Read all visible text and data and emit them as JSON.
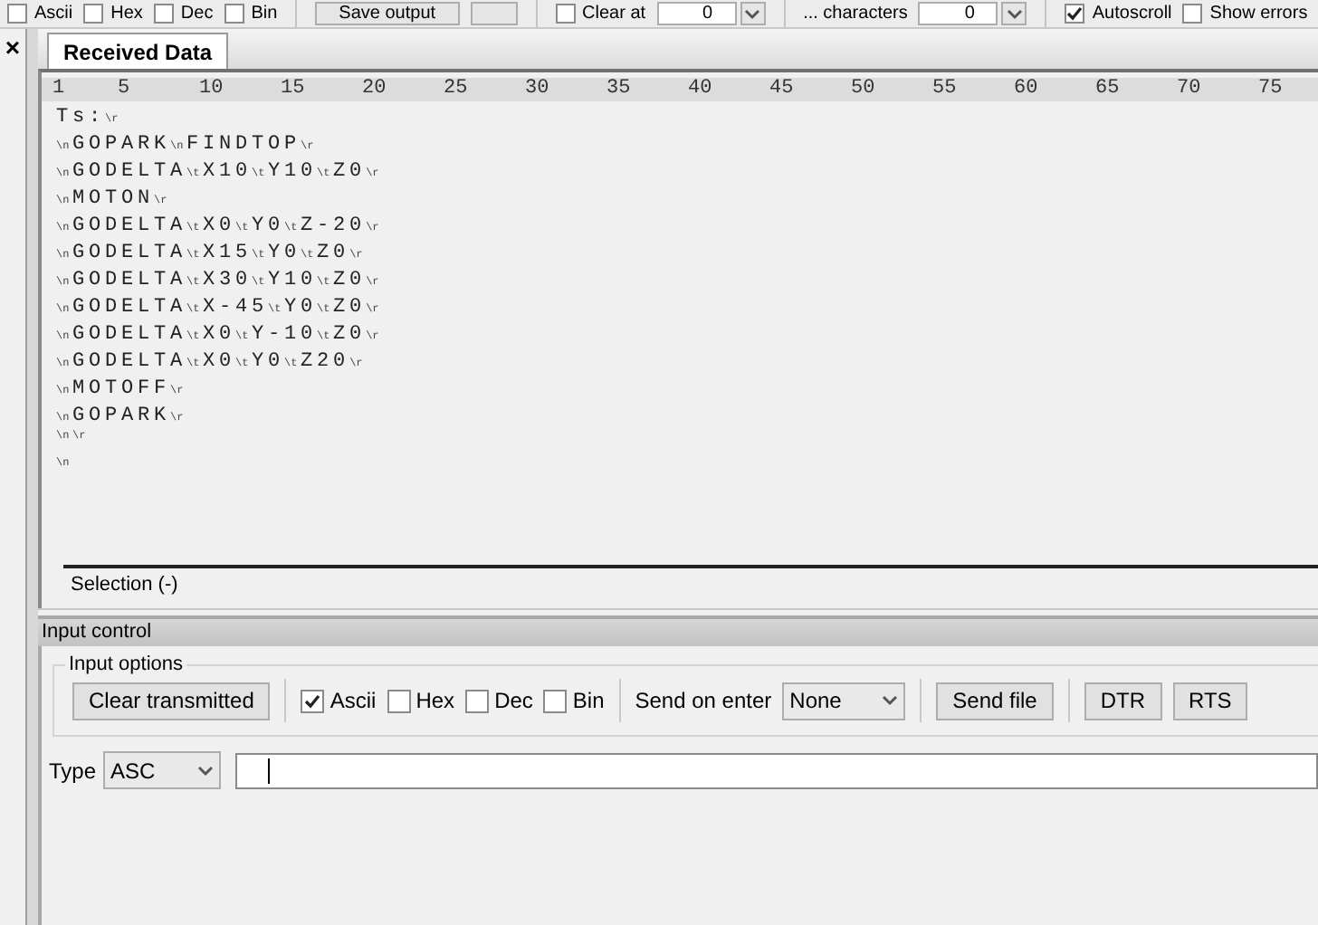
{
  "toolbar": {
    "items": [
      {
        "kind": "checkbox",
        "label": "Ascii",
        "checked": false
      },
      {
        "kind": "checkbox",
        "label": "Hex",
        "checked": false
      },
      {
        "kind": "checkbox",
        "label": "Dec",
        "checked": false
      },
      {
        "kind": "checkbox",
        "label": "Bin",
        "checked": false
      },
      {
        "kind": "sep"
      },
      {
        "kind": "button",
        "label": "Save output"
      },
      {
        "kind": "button"
      },
      {
        "kind": "sep"
      },
      {
        "kind": "checkbox",
        "label": "Clear at",
        "checked": false
      },
      {
        "kind": "spin",
        "value": "0"
      },
      {
        "kind": "sep"
      },
      {
        "kind": "text",
        "label": "... characters"
      },
      {
        "kind": "spin",
        "value": "0"
      },
      {
        "kind": "sep"
      },
      {
        "kind": "checkbox",
        "label": "Autoscroll",
        "checked": true
      },
      {
        "kind": "checkbox",
        "label": "Show errors",
        "checked": false
      }
    ]
  },
  "side_panel": {
    "close": "×"
  },
  "tabs": [
    {
      "label": "Received Data",
      "selected": true
    }
  ],
  "ruler": [
    "1",
    "5",
    "10",
    "15",
    "20",
    "25",
    "30",
    "35",
    "40",
    "45",
    "50",
    "55",
    "60",
    "65",
    "70",
    "75"
  ],
  "received_lines": [
    [
      {
        "kind": "text",
        "text": "Ts:"
      },
      {
        "kind": "ctrl",
        "text": "\\r"
      }
    ],
    [
      {
        "kind": "ctrl",
        "text": "\\n"
      },
      {
        "kind": "text",
        "text": "GOPARK"
      },
      {
        "kind": "ctrl",
        "text": "\\n"
      },
      {
        "kind": "text",
        "text": "FINDTOP"
      },
      {
        "kind": "ctrl",
        "text": "\\r"
      }
    ],
    [
      {
        "kind": "ctrl",
        "text": "\\n"
      },
      {
        "kind": "text",
        "text": "GODELTA"
      },
      {
        "kind": "ctrl",
        "text": "\\t"
      },
      {
        "kind": "text",
        "text": "X10"
      },
      {
        "kind": "ctrl",
        "text": "\\t"
      },
      {
        "kind": "text",
        "text": "Y10"
      },
      {
        "kind": "ctrl",
        "text": "\\t"
      },
      {
        "kind": "text",
        "text": "Z0"
      },
      {
        "kind": "ctrl",
        "text": "\\r"
      }
    ],
    [
      {
        "kind": "ctrl",
        "text": "\\n"
      },
      {
        "kind": "text",
        "text": "MOTON"
      },
      {
        "kind": "ctrl",
        "text": "\\r"
      }
    ],
    [
      {
        "kind": "ctrl",
        "text": "\\n"
      },
      {
        "kind": "text",
        "text": "GODELTA"
      },
      {
        "kind": "ctrl",
        "text": "\\t"
      },
      {
        "kind": "text",
        "text": "X0"
      },
      {
        "kind": "ctrl",
        "text": "\\t"
      },
      {
        "kind": "text",
        "text": "Y0"
      },
      {
        "kind": "ctrl",
        "text": "\\t"
      },
      {
        "kind": "text",
        "text": "Z-20"
      },
      {
        "kind": "ctrl",
        "text": "\\r"
      }
    ],
    [
      {
        "kind": "ctrl",
        "text": "\\n"
      },
      {
        "kind": "text",
        "text": "GODELTA"
      },
      {
        "kind": "ctrl",
        "text": "\\t"
      },
      {
        "kind": "text",
        "text": "X15"
      },
      {
        "kind": "ctrl",
        "text": "\\t"
      },
      {
        "kind": "text",
        "text": "Y0"
      },
      {
        "kind": "ctrl",
        "text": "\\t"
      },
      {
        "kind": "text",
        "text": "Z0"
      },
      {
        "kind": "ctrl",
        "text": "\\r"
      }
    ],
    [
      {
        "kind": "ctrl",
        "text": "\\n"
      },
      {
        "kind": "text",
        "text": "GODELTA"
      },
      {
        "kind": "ctrl",
        "text": "\\t"
      },
      {
        "kind": "text",
        "text": "X30"
      },
      {
        "kind": "ctrl",
        "text": "\\t"
      },
      {
        "kind": "text",
        "text": "Y10"
      },
      {
        "kind": "ctrl",
        "text": "\\t"
      },
      {
        "kind": "text",
        "text": "Z0"
      },
      {
        "kind": "ctrl",
        "text": "\\r"
      }
    ],
    [
      {
        "kind": "ctrl",
        "text": "\\n"
      },
      {
        "kind": "text",
        "text": "GODELTA"
      },
      {
        "kind": "ctrl",
        "text": "\\t"
      },
      {
        "kind": "text",
        "text": "X-45"
      },
      {
        "kind": "ctrl",
        "text": "\\t"
      },
      {
        "kind": "text",
        "text": "Y0"
      },
      {
        "kind": "ctrl",
        "text": "\\t"
      },
      {
        "kind": "text",
        "text": "Z0"
      },
      {
        "kind": "ctrl",
        "text": "\\r"
      }
    ],
    [
      {
        "kind": "ctrl",
        "text": "\\n"
      },
      {
        "kind": "text",
        "text": "GODELTA"
      },
      {
        "kind": "ctrl",
        "text": "\\t"
      },
      {
        "kind": "text",
        "text": "X0"
      },
      {
        "kind": "ctrl",
        "text": "\\t"
      },
      {
        "kind": "text",
        "text": "Y-10"
      },
      {
        "kind": "ctrl",
        "text": "\\t"
      },
      {
        "kind": "text",
        "text": "Z0"
      },
      {
        "kind": "ctrl",
        "text": "\\r"
      }
    ],
    [
      {
        "kind": "ctrl",
        "text": "\\n"
      },
      {
        "kind": "text",
        "text": "GODELTA"
      },
      {
        "kind": "ctrl",
        "text": "\\t"
      },
      {
        "kind": "text",
        "text": "X0"
      },
      {
        "kind": "ctrl",
        "text": "\\t"
      },
      {
        "kind": "text",
        "text": "Y0"
      },
      {
        "kind": "ctrl",
        "text": "\\t"
      },
      {
        "kind": "text",
        "text": "Z20"
      },
      {
        "kind": "ctrl",
        "text": "\\r"
      }
    ],
    [
      {
        "kind": "ctrl",
        "text": "\\n"
      },
      {
        "kind": "text",
        "text": "MOTOFF"
      },
      {
        "kind": "ctrl",
        "text": "\\r"
      }
    ],
    [
      {
        "kind": "ctrl",
        "text": "\\n"
      },
      {
        "kind": "text",
        "text": "GOPARK"
      },
      {
        "kind": "ctrl",
        "text": "\\r"
      }
    ],
    [
      {
        "kind": "ctrl",
        "text": "\\n"
      },
      {
        "kind": "ctrl",
        "text": "\\r"
      }
    ],
    [
      {
        "kind": "ctrl",
        "text": "\\n"
      }
    ]
  ],
  "selection": "Selection (-)",
  "input_control": {
    "title": "Input control",
    "group_title": "Input options",
    "items": [
      {
        "kind": "button",
        "label": "Clear transmitted"
      },
      {
        "kind": "sep"
      },
      {
        "kind": "checkbox",
        "label": "Ascii",
        "checked": true
      },
      {
        "kind": "checkbox",
        "label": "Hex",
        "checked": false
      },
      {
        "kind": "checkbox",
        "label": "Dec",
        "checked": false
      },
      {
        "kind": "checkbox",
        "label": "Bin",
        "checked": false
      },
      {
        "kind": "sep"
      },
      {
        "kind": "label",
        "label": "Send on enter"
      },
      {
        "kind": "select",
        "value": "None"
      },
      {
        "kind": "sep"
      },
      {
        "kind": "button",
        "label": "Send file"
      },
      {
        "kind": "sep"
      },
      {
        "kind": "button",
        "label": "DTR"
      },
      {
        "kind": "button",
        "label": "RTS"
      }
    ],
    "type_label": "Type",
    "type_value": "ASC"
  }
}
